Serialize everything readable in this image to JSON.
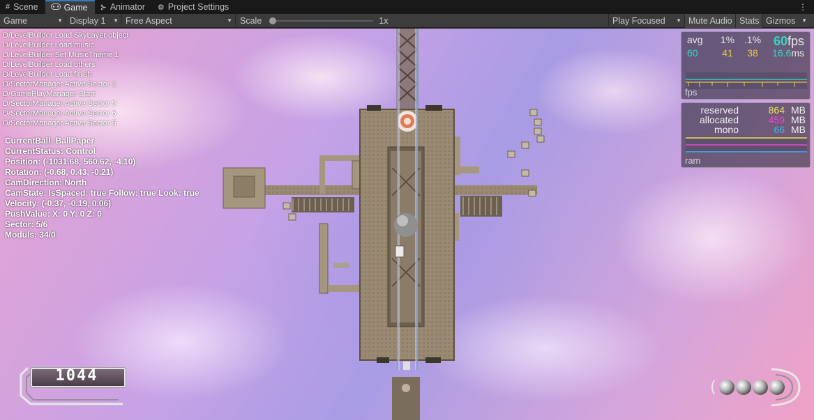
{
  "tabs": [
    {
      "label": "Scene",
      "icon": "grid-icon"
    },
    {
      "label": "Game",
      "icon": "gamepad-icon"
    },
    {
      "label": "Animator",
      "icon": "animator-icon"
    },
    {
      "label": "Project Settings",
      "icon": "gear-icon"
    }
  ],
  "toolbar": {
    "view": "Game",
    "display": "Display 1",
    "aspect": "Free Aspect",
    "scale_label": "Scale",
    "scale_value": "1x",
    "scale_fraction": 0.0,
    "play_mode": "Play Focused",
    "mute": "Mute Audio",
    "stats": "Stats",
    "gizmos": "Gizmos"
  },
  "console_lines": [
    "D/LevelBuilder Load SkyLayer object",
    "D/LevelBuilder Load music",
    "D/LevelBuilder Set MusicTheme 1",
    "D/LevelBuilder Load others",
    "D/LevelBuilder Load finish",
    "D/SectorManager Active Sector 1",
    "D/GamePlayManager Start",
    "D/SectorManager Active Sector 5",
    "D/SectorManager Active Sector 6",
    "D/SectorManager Active Sector 5"
  ],
  "debug_lines": [
    "CurrentBall: BallPaper",
    "CurrentStatus: Control",
    "Position: (-1031.68, 560.62, -4.10)",
    "Rotation: (-0.68, 0.43, -0.21)",
    "CamDirection: North",
    "CamState: IsSpaced: true Follow: true Look: true",
    "Velocity: (-0.37, -0.19, 0.06)",
    "PushValue: X: 0 Y: 0 Z: 0",
    "Sector: 5/6",
    "Moduls: 34/0"
  ],
  "fps": {
    "headers": [
      "avg",
      "1%",
      ".1%"
    ],
    "values": [
      "60",
      "41",
      "38"
    ],
    "current": "60",
    "current_unit": "fps",
    "frame_ms": "16.6",
    "frame_unit": "ms",
    "caption": "fps",
    "colors": {
      "avg": "#2fd8c4",
      "p1": "#e8c84a",
      "p01": "#e8c84a",
      "current": "#2fd8c4"
    }
  },
  "ram": {
    "rows": [
      {
        "label": "reserved",
        "value": "864",
        "unit": "MB",
        "color": "#f0e15a"
      },
      {
        "label": "allocated",
        "value": "459",
        "unit": "MB",
        "color": "#e84ad0"
      },
      {
        "label": "mono",
        "value": "66",
        "unit": "MB",
        "color": "#3fb4e8"
      }
    ],
    "caption": "ram"
  },
  "hud": {
    "score": "1044",
    "lives": 4
  },
  "colors": {
    "tab_accent": "#3a79bb",
    "toolbar_bg": "#3c3c3c",
    "wood": "#9a8a74"
  }
}
